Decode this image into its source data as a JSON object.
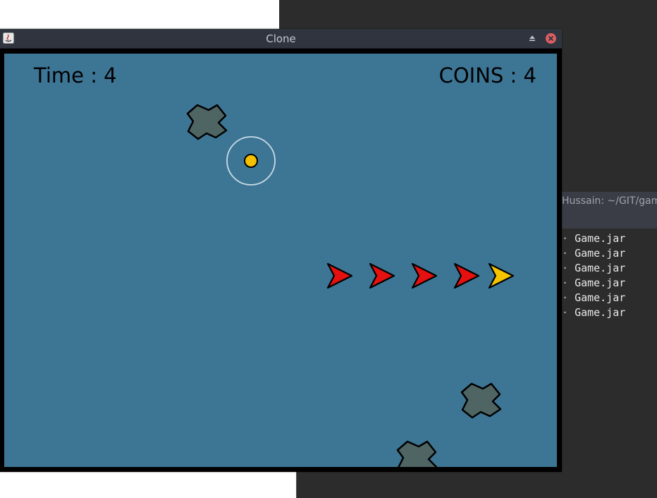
{
  "window": {
    "title": "Clone"
  },
  "hud": {
    "time_text": "Time : 4",
    "coins_text": "COINS : 4"
  },
  "terminal": {
    "title": "Hussain: ~/GIT/gam",
    "lines": [
      "Game.jar",
      "Game.jar",
      "Game.jar",
      "Game.jar",
      "Game.jar",
      "Game.jar"
    ]
  },
  "colors": {
    "game_background": "#3d7595",
    "player_body": "#f5c400",
    "enemy_body": "#e51010",
    "asteroid": "#4f6563",
    "coin": "#f5c000",
    "coin_ring": "#c9dbe6"
  },
  "icons": {
    "app": "java-icon",
    "maximize": "eject-icon",
    "close": "close-icon"
  }
}
